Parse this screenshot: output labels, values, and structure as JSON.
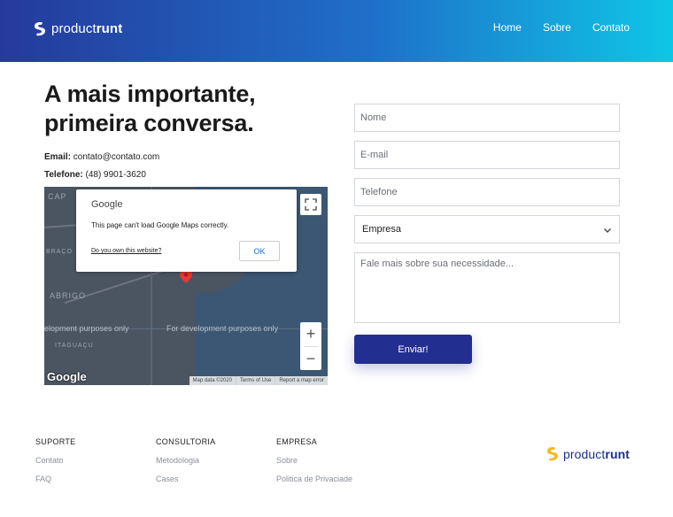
{
  "header": {
    "logo": {
      "light": "product",
      "bold": "runt"
    },
    "nav": [
      "Home",
      "Sobre",
      "Contato"
    ]
  },
  "main": {
    "headline_line1": "A mais importante,",
    "headline_line2": "primeira conversa.",
    "email_label": "Email:",
    "email_value": "contato@contato.com",
    "phone_label": "Telefone:",
    "phone_value": "(48) 9901-3620"
  },
  "map": {
    "labels": [
      "CAP",
      "BRAÇO",
      "ABRIGO",
      "ITAGUAÇU"
    ],
    "dev_text": "For development purposes only",
    "dev_text_left": "elopment purposes only",
    "watermark": "Google",
    "attribution": [
      "Map data ©2020",
      "Terms of Use",
      "Report a map error"
    ],
    "dialog": {
      "title": "Google",
      "message": "This page can't load Google Maps correctly.",
      "link": "Do you own this website?",
      "ok": "OK"
    }
  },
  "form": {
    "nome_placeholder": "Nome",
    "email_placeholder": "E-mail",
    "telefone_placeholder": "Telefone",
    "empresa_selected": "Empresa",
    "mensagem_placeholder": "Fale mais sobre sua necessidade...",
    "submit_label": "Enviar!"
  },
  "footer": {
    "suporte": {
      "title": "SUPORTE",
      "links": [
        "Contato",
        "FAQ"
      ]
    },
    "consultoria": {
      "title": "CONSULTORIA",
      "links": [
        "Metodologia",
        "Cases"
      ]
    },
    "empresa": {
      "title": "EMPRESA",
      "links": [
        "Sobre",
        "Politica de Privaciade"
      ]
    },
    "logo": {
      "light": "product",
      "bold": "runt"
    }
  },
  "colors": {
    "header_gradient_start": "#253a9c",
    "header_gradient_end": "#0fc6e6",
    "button": "#232e91",
    "logo_mark_footer": "#f5b921"
  }
}
